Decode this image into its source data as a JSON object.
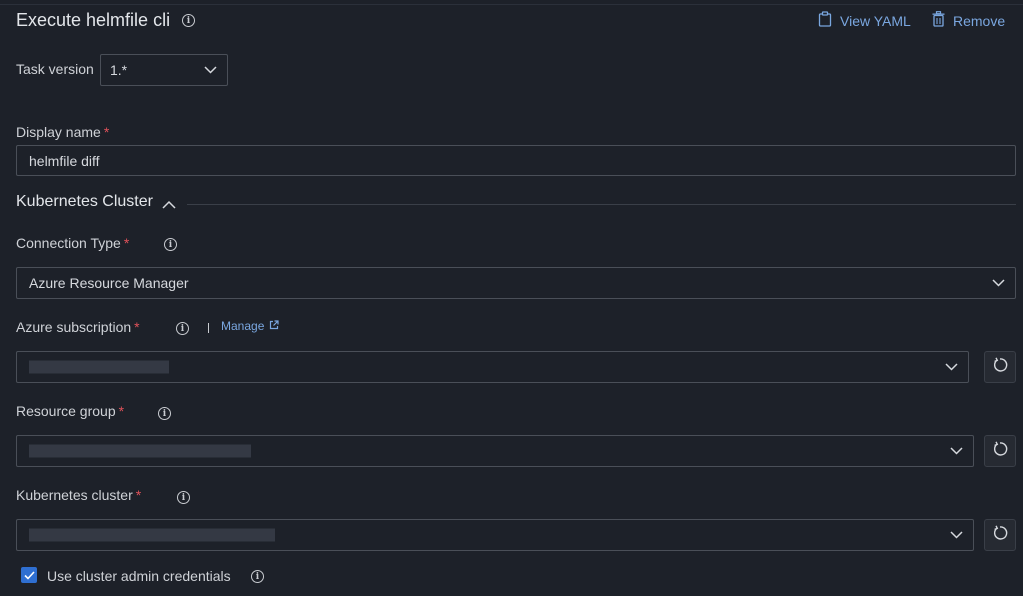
{
  "header": {
    "title": "Execute helmfile cli",
    "view_yaml_label": "View YAML",
    "remove_label": "Remove"
  },
  "task_version": {
    "label": "Task version",
    "value": "1.*"
  },
  "display_name": {
    "label": "Display name",
    "required_marker": "*",
    "value": "helmfile diff"
  },
  "kubernetes_section": {
    "title": "Kubernetes Cluster"
  },
  "connection_type": {
    "label": "Connection Type",
    "required_marker": "*",
    "value": "Azure Resource Manager"
  },
  "azure_subscription": {
    "label": "Azure subscription",
    "required_marker": "*",
    "manage_label": "Manage"
  },
  "resource_group": {
    "label": "Resource group",
    "required_marker": "*"
  },
  "kubernetes_cluster": {
    "label": "Kubernetes cluster",
    "required_marker": "*"
  },
  "admin_credentials": {
    "label": "Use cluster admin credentials",
    "checked": true
  },
  "colors": {
    "background": "#1d2129",
    "accent": "#2f6fd1",
    "link": "#7aa7e0",
    "required": "#e0525a"
  }
}
